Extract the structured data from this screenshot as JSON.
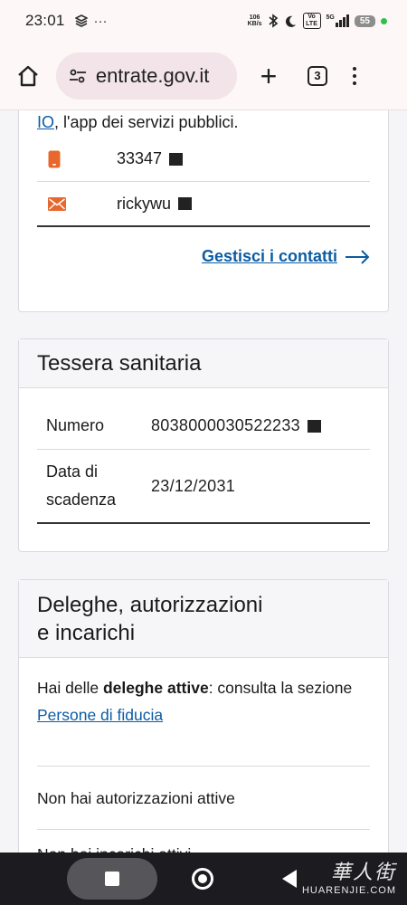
{
  "status_bar": {
    "time": "23:01",
    "notification_more": "···",
    "net_speed_value": "106",
    "net_speed_unit": "KB/s",
    "volte": "Vo LTE",
    "network": "5G",
    "battery": "55"
  },
  "browser": {
    "url": " entrate.gov.it",
    "tab_count": "3",
    "new_tab": "+"
  },
  "contacts": {
    "io_link": "IO",
    "io_text": ", l'app dei servizi pubblici.",
    "phone": "33347",
    "email": "rickywu",
    "manage_link": "Gestisci i contatti"
  },
  "tessera": {
    "title": "Tessera sanitaria",
    "numero_label": "Numero",
    "numero_value": "8038000030522233",
    "scadenza_label_1": "Data di",
    "scadenza_label_2": "scadenza",
    "scadenza_value": "23/12/2031"
  },
  "deleghe": {
    "title_1": "Deleghe, autorizzazioni",
    "title_2": "e incarichi",
    "deleghe_prefix": "Hai delle ",
    "deleghe_bold": "deleghe attive",
    "deleghe_suffix": ": consulta la sezione",
    "persone_link": "Persone di fiducia",
    "autorizzazioni": "Non hai autorizzazioni attive",
    "incarichi": "Non hai incarichi attivi"
  },
  "watermark": {
    "cn": "華人街",
    "en": "HUARENJIE.COM"
  },
  "colors": {
    "accent_blue": "#0b5ca4",
    "icon_orange": "#e8672c"
  }
}
